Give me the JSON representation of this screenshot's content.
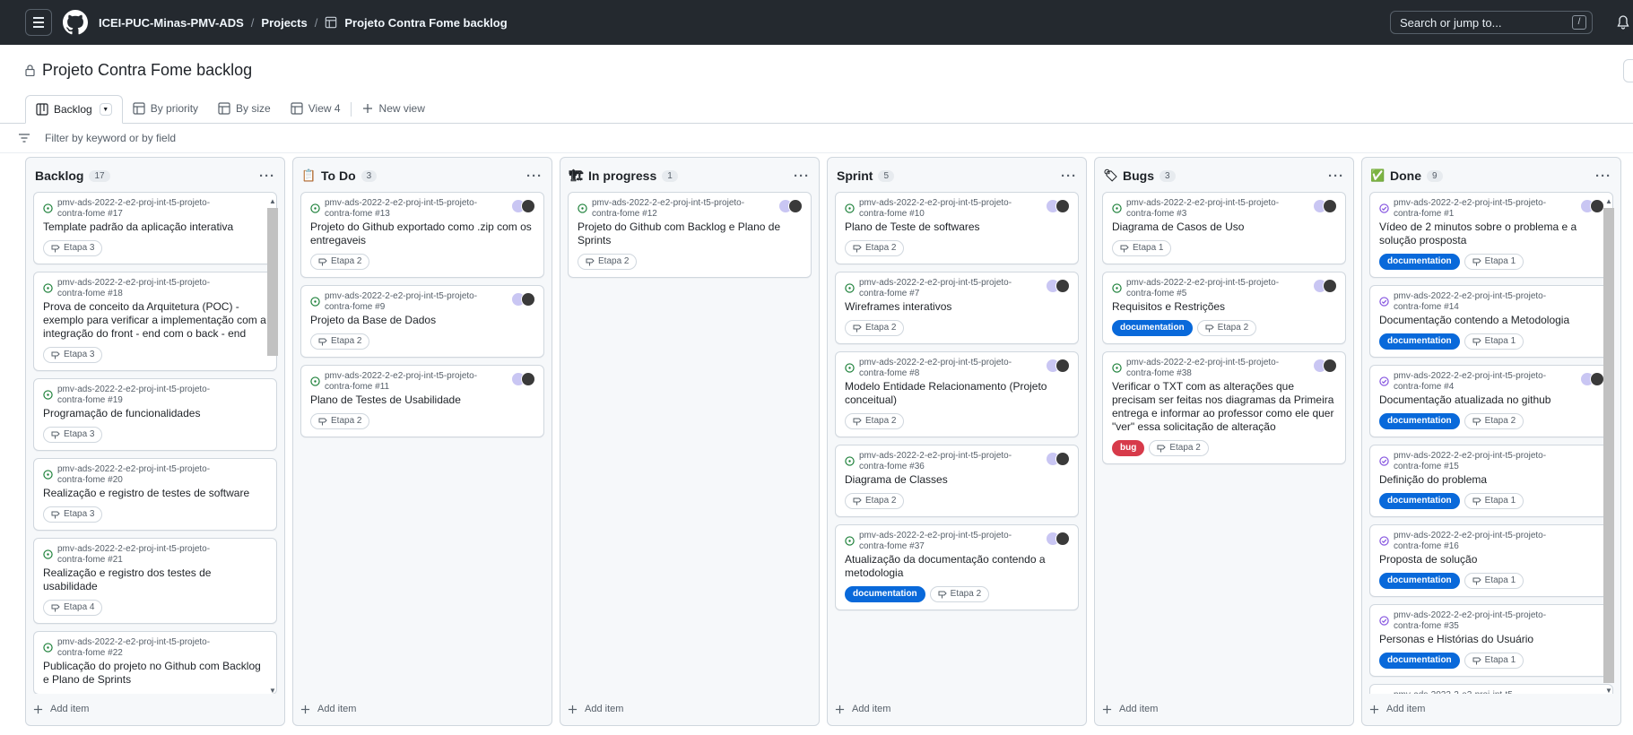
{
  "header": {
    "org": "ICEI-PUC-Minas-PMV-ADS",
    "projects": "Projects",
    "project": "Projeto Contra Fome backlog",
    "search_placeholder": "Search or jump to...",
    "search_shortcut": "/"
  },
  "title": "Projeto Contra Fome backlog",
  "tabs": [
    {
      "label": "Backlog"
    },
    {
      "label": "By priority"
    },
    {
      "label": "By size"
    },
    {
      "label": "View 4"
    },
    {
      "label": "New view"
    }
  ],
  "filter_placeholder": "Filter by keyword or by field",
  "add_item_label": "Add item",
  "colors": {
    "documentation": "#0969da",
    "bug": "#d73a4a",
    "open": "#1a7f37",
    "done": "#8250df"
  },
  "columns": [
    {
      "name": "Backlog",
      "count": "17",
      "icon": "none",
      "status": "open",
      "cards": [
        {
          "ref": "pmv-ads-2022-2-e2-proj-int-t5-projeto-contra-fome #17",
          "title": "Template padrão da aplicação interativa",
          "labels": [],
          "etapa": "Etapa 3",
          "avatars": false
        },
        {
          "ref": "pmv-ads-2022-2-e2-proj-int-t5-projeto-contra-fome #18",
          "title": "Prova de conceito da Arquitetura (POC) - exemplo para verificar a implementação com a integração do front - end com o back - end",
          "labels": [],
          "etapa": "Etapa 3",
          "avatars": false
        },
        {
          "ref": "pmv-ads-2022-2-e2-proj-int-t5-projeto-contra-fome #19",
          "title": "Programação de funcionalidades",
          "labels": [],
          "etapa": "Etapa 3",
          "avatars": false
        },
        {
          "ref": "pmv-ads-2022-2-e2-proj-int-t5-projeto-contra-fome #20",
          "title": "Realização e registro de testes de software",
          "labels": [],
          "etapa": "Etapa 3",
          "avatars": false
        },
        {
          "ref": "pmv-ads-2022-2-e2-proj-int-t5-projeto-contra-fome #21",
          "title": "Realização e registro dos testes de usabilidade",
          "labels": [],
          "etapa": "Etapa 4",
          "avatars": false
        },
        {
          "ref": "pmv-ads-2022-2-e2-proj-int-t5-projeto-contra-fome #22",
          "title": "Publicação do projeto no Github com Backlog e Plano de Sprints",
          "labels": [],
          "etapa": "",
          "avatars": false
        }
      ]
    },
    {
      "name": "To Do",
      "count": "3",
      "icon": "clipboard-icon",
      "status": "open",
      "cards": [
        {
          "ref": "pmv-ads-2022-2-e2-proj-int-t5-projeto-contra-fome #13",
          "title": "Projeto do Github exportado como .zip com os entregaveis",
          "labels": [],
          "etapa": "Etapa 2",
          "avatars": true
        },
        {
          "ref": "pmv-ads-2022-2-e2-proj-int-t5-projeto-contra-fome #9",
          "title": "Projeto da Base de Dados",
          "labels": [],
          "etapa": "Etapa 2",
          "avatars": true
        },
        {
          "ref": "pmv-ads-2022-2-e2-proj-int-t5-projeto-contra-fome #11",
          "title": "Plano de Testes de Usabilidade",
          "labels": [],
          "etapa": "Etapa 2",
          "avatars": true
        }
      ]
    },
    {
      "name": "In progress",
      "count": "1",
      "icon": "construction-icon",
      "status": "open",
      "cards": [
        {
          "ref": "pmv-ads-2022-2-e2-proj-int-t5-projeto-contra-fome #12",
          "title": "Projeto do Github com Backlog e Plano de Sprints",
          "labels": [],
          "etapa": "Etapa 2",
          "avatars": true
        }
      ]
    },
    {
      "name": "Sprint",
      "count": "5",
      "icon": "none",
      "status": "open",
      "cards": [
        {
          "ref": "pmv-ads-2022-2-e2-proj-int-t5-projeto-contra-fome #10",
          "title": "Plano de Teste de softwares",
          "labels": [],
          "etapa": "Etapa 2",
          "avatars": true
        },
        {
          "ref": "pmv-ads-2022-2-e2-proj-int-t5-projeto-contra-fome #7",
          "title": "Wireframes interativos",
          "labels": [],
          "etapa": "Etapa 2",
          "avatars": true
        },
        {
          "ref": "pmv-ads-2022-2-e2-proj-int-t5-projeto-contra-fome #8",
          "title": "Modelo Entidade Relacionamento (Projeto conceitual)",
          "labels": [],
          "etapa": "Etapa 2",
          "avatars": true
        },
        {
          "ref": "pmv-ads-2022-2-e2-proj-int-t5-projeto-contra-fome #36",
          "title": "Diagrama de Classes",
          "labels": [],
          "etapa": "Etapa 2",
          "avatars": true
        },
        {
          "ref": "pmv-ads-2022-2-e2-proj-int-t5-projeto-contra-fome #37",
          "title": "Atualização da documentação contendo a metodologia",
          "labels": [
            "documentation"
          ],
          "etapa": "Etapa 2",
          "avatars": true
        }
      ]
    },
    {
      "name": "Bugs",
      "count": "3",
      "icon": "tag-icon",
      "status": "open",
      "cards": [
        {
          "ref": "pmv-ads-2022-2-e2-proj-int-t5-projeto-contra-fome #3",
          "title": "Diagrama de Casos de Uso",
          "labels": [],
          "etapa": "Etapa 1",
          "avatars": true
        },
        {
          "ref": "pmv-ads-2022-2-e2-proj-int-t5-projeto-contra-fome #5",
          "title": "Requisitos e Restrições",
          "labels": [
            "documentation"
          ],
          "etapa": "Etapa 2",
          "avatars": true
        },
        {
          "ref": "pmv-ads-2022-2-e2-proj-int-t5-projeto-contra-fome #38",
          "title": "Verificar o TXT com as alterações que precisam ser feitas nos diagramas da Primeira entrega e informar ao professor como ele quer \"ver\" essa solicitação de alteração",
          "labels": [
            "bug"
          ],
          "etapa": "Etapa 2",
          "avatars": true
        }
      ]
    },
    {
      "name": "Done",
      "count": "9",
      "icon": "check-box-icon",
      "status": "done",
      "cards": [
        {
          "ref": "pmv-ads-2022-2-e2-proj-int-t5-projeto-contra-fome #1",
          "title": "Vídeo de 2 minutos sobre o problema e a solução prosposta",
          "labels": [
            "documentation"
          ],
          "etapa": "Etapa 1",
          "avatars": true
        },
        {
          "ref": "pmv-ads-2022-2-e2-proj-int-t5-projeto-contra-fome #14",
          "title": "Documentação contendo a Metodologia",
          "labels": [
            "documentation"
          ],
          "etapa": "Etapa 1",
          "avatars": false
        },
        {
          "ref": "pmv-ads-2022-2-e2-proj-int-t5-projeto-contra-fome #4",
          "title": "Documentação atualizada no github",
          "labels": [
            "documentation"
          ],
          "etapa": "Etapa 2",
          "avatars": true
        },
        {
          "ref": "pmv-ads-2022-2-e2-proj-int-t5-projeto-contra-fome #15",
          "title": "Definição do problema",
          "labels": [
            "documentation"
          ],
          "etapa": "Etapa 1",
          "avatars": false
        },
        {
          "ref": "pmv-ads-2022-2-e2-proj-int-t5-projeto-contra-fome #16",
          "title": "Proposta de solução",
          "labels": [
            "documentation"
          ],
          "etapa": "Etapa 1",
          "avatars": false
        },
        {
          "ref": "pmv-ads-2022-2-e2-proj-int-t5-projeto-contra-fome #35",
          "title": "Personas e Histórias do Usuário",
          "labels": [
            "documentation"
          ],
          "etapa": "Etapa 1",
          "avatars": false
        },
        {
          "ref": "pmv-ads-2022-2-e2-proj-int-t5-",
          "title": "",
          "labels": [],
          "etapa": "",
          "avatars": false
        }
      ]
    }
  ]
}
